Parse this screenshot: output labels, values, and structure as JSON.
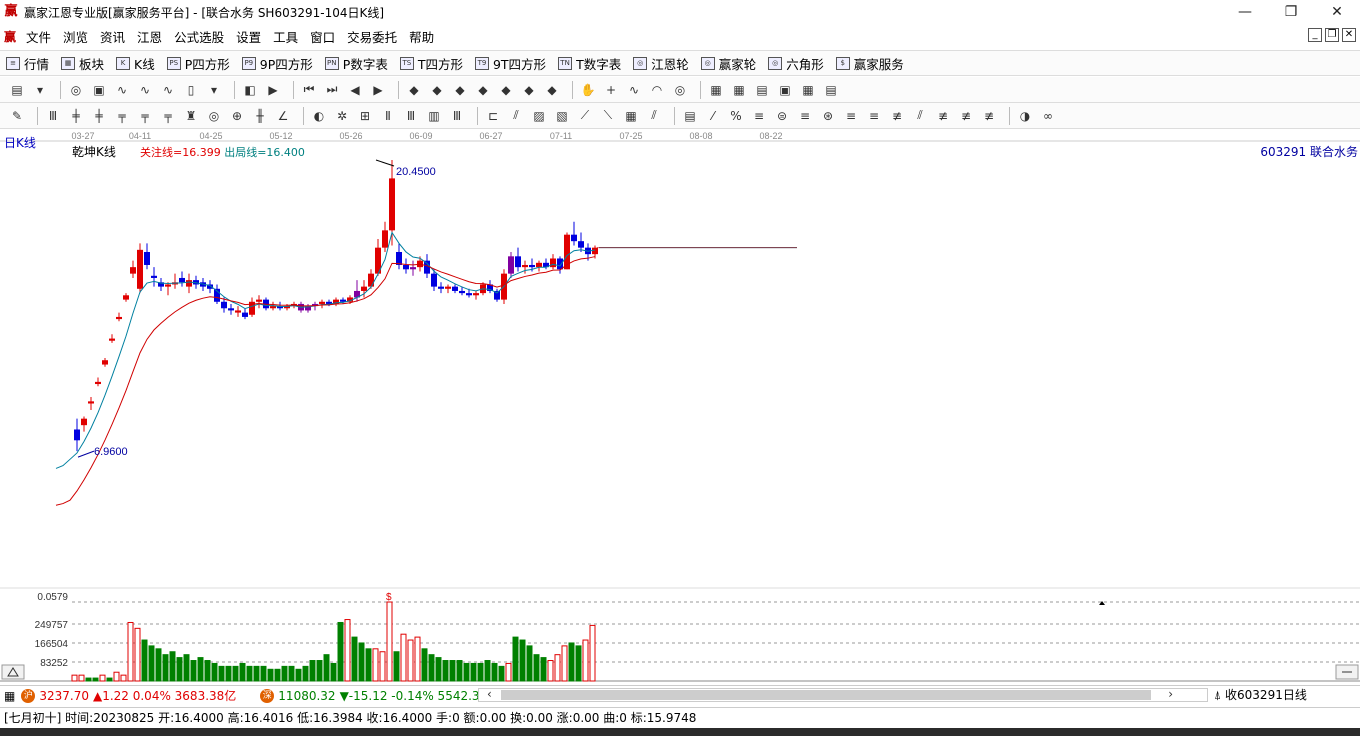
{
  "window": {
    "title": "赢家江恩专业版[赢家服务平台] - [联合水务   SH603291-104日K线]",
    "logo": "赢"
  },
  "menu": {
    "logo": "赢",
    "items": [
      "文件",
      "浏览",
      "资讯",
      "江恩",
      "公式选股",
      "设置",
      "工具",
      "窗口",
      "交易委托",
      "帮助"
    ]
  },
  "toolbar1": {
    "items": [
      {
        "icon": "≡",
        "label": "行情"
      },
      {
        "icon": "▦",
        "label": "板块"
      },
      {
        "icon": "K",
        "label": "K线"
      },
      {
        "icon": "PS",
        "label": "P四方形"
      },
      {
        "icon": "P9",
        "label": "9P四方形"
      },
      {
        "icon": "PN",
        "label": "P数字表"
      },
      {
        "icon": "TS",
        "label": "T四方形"
      },
      {
        "icon": "T9",
        "label": "9T四方形"
      },
      {
        "icon": "TN",
        "label": "T数字表"
      },
      {
        "icon": "◎",
        "label": "江恩轮"
      },
      {
        "icon": "◎",
        "label": "赢家轮"
      },
      {
        "icon": "◎",
        "label": "六角形"
      },
      {
        "icon": "$",
        "label": "赢家服务"
      }
    ]
  },
  "chart": {
    "tab": "日K线",
    "indicator_name": "乾坤K线",
    "watch_line": "关注线=16.399",
    "exit_line": "出局线=16.400",
    "stock": "603291  联合水务",
    "high_label": "20.4500",
    "low_label": "6.9600",
    "date_ticks": [
      "03-27",
      "04-11",
      "04-25",
      "05-12",
      "05-26",
      "06-09",
      "06-27",
      "07-11",
      "07-25",
      "08-08",
      "08-22"
    ],
    "vol_labels": [
      "0.0579",
      "249757",
      "166504",
      "83252"
    ],
    "vol_marker": "$",
    "colors": {
      "up": "#e00000",
      "down": "#0000e0",
      "purple": "#8000a0",
      "vol_green": "#008000",
      "ma_fast": "#0080a0",
      "ma_slow": "#d00000"
    }
  },
  "chart_data": {
    "type": "candlestick",
    "candles": [
      [
        8.0,
        8.5,
        7.0,
        7.5
      ],
      [
        8.2,
        8.6,
        7.9,
        8.5
      ],
      [
        9.2,
        9.5,
        8.9,
        9.3
      ],
      [
        10.1,
        10.4,
        10.0,
        10.2
      ],
      [
        11.0,
        11.3,
        10.9,
        11.2
      ],
      [
        12.1,
        12.4,
        12.0,
        12.2
      ],
      [
        13.1,
        13.4,
        13.0,
        13.2
      ],
      [
        14.0,
        14.3,
        13.9,
        14.2
      ],
      [
        15.2,
        15.8,
        15.0,
        15.5
      ],
      [
        14.5,
        16.6,
        14.3,
        16.3
      ],
      [
        16.2,
        16.6,
        15.4,
        15.6
      ],
      [
        15.1,
        15.5,
        14.6,
        15.0
      ],
      [
        14.8,
        15.0,
        14.4,
        14.6
      ],
      [
        14.6,
        14.8,
        14.2,
        14.7
      ],
      [
        14.7,
        15.2,
        14.5,
        14.8
      ],
      [
        15.0,
        15.3,
        14.6,
        14.8
      ],
      [
        14.6,
        15.2,
        14.3,
        14.9
      ],
      [
        14.9,
        15.1,
        14.5,
        14.7
      ],
      [
        14.8,
        15.0,
        14.4,
        14.6
      ],
      [
        14.7,
        14.9,
        14.3,
        14.5
      ],
      [
        14.5,
        14.7,
        13.8,
        13.9
      ],
      [
        13.9,
        14.1,
        13.4,
        13.6
      ],
      [
        13.6,
        13.8,
        13.3,
        13.5
      ],
      [
        13.4,
        13.7,
        13.2,
        13.5
      ],
      [
        13.4,
        13.6,
        13.1,
        13.2
      ],
      [
        13.3,
        14.1,
        13.2,
        13.9
      ],
      [
        13.9,
        14.2,
        13.6,
        14.0
      ],
      [
        14.0,
        14.1,
        13.5,
        13.6
      ],
      [
        13.6,
        13.9,
        13.5,
        13.7
      ],
      [
        13.7,
        13.9,
        13.5,
        13.6
      ],
      [
        13.6,
        13.8,
        13.5,
        13.7
      ],
      [
        13.7,
        13.9,
        13.6,
        13.8
      ],
      [
        13.8,
        13.9,
        13.4,
        13.5
      ],
      [
        13.5,
        13.8,
        13.4,
        13.7
      ],
      [
        13.7,
        13.9,
        13.5,
        13.8
      ],
      [
        13.8,
        14.0,
        13.6,
        13.9
      ],
      [
        13.9,
        14.0,
        13.7,
        13.8
      ],
      [
        13.8,
        14.1,
        13.7,
        14.0
      ],
      [
        14.0,
        14.1,
        13.8,
        13.9
      ],
      [
        13.9,
        14.2,
        13.8,
        14.1
      ],
      [
        14.1,
        14.9,
        13.9,
        14.4
      ],
      [
        14.4,
        14.9,
        14.1,
        14.6
      ],
      [
        14.6,
        15.4,
        14.5,
        15.2
      ],
      [
        15.2,
        16.8,
        15.1,
        16.4
      ],
      [
        16.4,
        17.6,
        16.2,
        17.2
      ],
      [
        17.2,
        20.45,
        16.5,
        19.6
      ],
      [
        16.2,
        16.6,
        15.4,
        15.6
      ],
      [
        15.6,
        15.9,
        15.2,
        15.4
      ],
      [
        15.4,
        15.8,
        15.1,
        15.5
      ],
      [
        15.5,
        16.0,
        15.3,
        15.8
      ],
      [
        15.8,
        16.1,
        15.0,
        15.2
      ],
      [
        15.2,
        15.4,
        14.4,
        14.6
      ],
      [
        14.6,
        14.8,
        14.3,
        14.5
      ],
      [
        14.5,
        14.7,
        14.3,
        14.6
      ],
      [
        14.6,
        14.7,
        14.3,
        14.4
      ],
      [
        14.4,
        14.6,
        14.2,
        14.3
      ],
      [
        14.3,
        14.5,
        14.1,
        14.2
      ],
      [
        14.2,
        14.4,
        14.0,
        14.3
      ],
      [
        14.3,
        14.8,
        14.2,
        14.7
      ],
      [
        14.7,
        14.9,
        14.3,
        14.4
      ],
      [
        14.4,
        14.5,
        13.9,
        14.0
      ],
      [
        14.0,
        15.4,
        13.8,
        15.2
      ],
      [
        15.2,
        16.2,
        15.0,
        16.0
      ],
      [
        16.0,
        16.4,
        15.3,
        15.5
      ],
      [
        15.5,
        15.8,
        15.2,
        15.6
      ],
      [
        15.6,
        15.9,
        15.3,
        15.5
      ],
      [
        15.5,
        15.8,
        15.3,
        15.7
      ],
      [
        15.7,
        15.9,
        15.4,
        15.5
      ],
      [
        15.5,
        16.1,
        15.4,
        15.9
      ],
      [
        15.9,
        16.0,
        15.2,
        15.4
      ],
      [
        15.4,
        17.1,
        15.4,
        17.0
      ],
      [
        17.0,
        17.6,
        16.5,
        16.7
      ],
      [
        16.7,
        17.1,
        16.2,
        16.4
      ],
      [
        16.4,
        16.6,
        15.8,
        16.1
      ],
      [
        16.1,
        16.5,
        15.9,
        16.4
      ]
    ],
    "volumes": [
      2,
      2,
      1,
      1,
      2,
      1,
      3,
      2,
      20,
      18,
      14,
      12,
      11,
      9,
      10,
      8,
      9,
      7,
      8,
      7,
      6,
      5,
      5,
      5,
      6,
      5,
      5,
      5,
      4,
      4,
      5,
      5,
      4,
      5,
      7,
      7,
      9,
      6,
      20,
      21,
      15,
      13,
      11,
      11,
      10,
      27,
      10,
      16,
      14,
      15,
      11,
      9,
      8,
      7,
      7,
      7,
      6,
      6,
      6,
      7,
      6,
      5,
      6,
      15,
      14,
      12,
      9,
      8,
      7,
      9,
      12,
      13,
      12,
      14,
      19
    ],
    "vol_up": [
      1,
      1,
      0,
      0,
      1,
      0,
      1,
      1,
      1,
      1,
      0,
      0,
      0,
      0,
      0,
      0,
      0,
      0,
      0,
      0,
      0,
      0,
      0,
      0,
      0,
      0,
      0,
      0,
      0,
      0,
      0,
      0,
      0,
      0,
      0,
      0,
      0,
      0,
      0,
      1,
      0,
      0,
      0,
      1,
      1,
      1,
      0,
      1,
      1,
      1,
      0,
      0,
      0,
      0,
      0,
      0,
      0,
      0,
      0,
      0,
      0,
      0,
      1,
      0,
      0,
      0,
      0,
      0,
      1,
      1,
      1,
      0,
      0,
      1,
      1
    ],
    "ylim": [
      6.5,
      21.5
    ]
  },
  "statusbar": {
    "sh_index": "3237.70",
    "sh_change": "▲1.22 0.04% 3683.38亿",
    "sz_index": "11080.32",
    "sz_change": "▼-15.12 -0.14% 5542.38",
    "right_text": "收603291日线"
  },
  "infobar": {
    "text": "[七月初十] 时间:20230825 开:16.4000 高:16.4016 低:16.3984 收:16.4000 手:0 额:0.00 换:0.00 涨:0.00 曲:0 标:15.9748"
  }
}
